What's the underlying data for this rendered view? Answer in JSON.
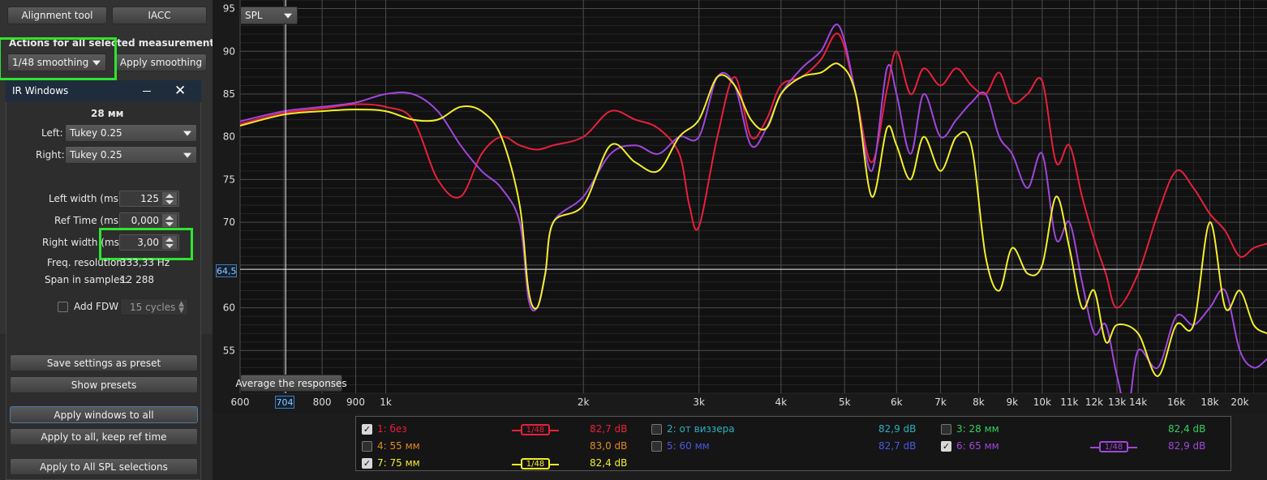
{
  "top_buttons": {
    "alignment": "Alignment tool",
    "iacc": "IACC"
  },
  "actions": {
    "title": "Actions for all selected measurements",
    "smoothing_value": "1/48 smoothing",
    "apply_label": "Apply smoothing"
  },
  "ir_window": {
    "title": "IR Windows",
    "distance": "28 мм",
    "left_label": "Left:",
    "left_value": "Tukey 0.25",
    "right_label": "Right:",
    "right_value": "Tukey 0.25",
    "left_width_label": "Left width (ms):",
    "left_width_value": "125",
    "ref_time_label": "Ref Time (ms):",
    "ref_time_value": "0,000",
    "right_width_label": "Right width (ms):",
    "right_width_value": "3,00",
    "freq_res_label": "Freq. resolution:",
    "freq_res_value": "333,33 Hz",
    "span_label": "Span in samples:",
    "span_value": "12 288",
    "fdw_label": "Add FDW",
    "fdw_value": "15 cycles",
    "save_preset": "Save settings as preset",
    "show_presets": "Show presets",
    "apply_all": "Apply windows to all",
    "apply_keep": "Apply to all, keep ref time",
    "apply_spl": "Apply to All SPL selections"
  },
  "chart_controls": {
    "mode": "SPL",
    "average_button": "Average the responses",
    "cursor_y": "64,5",
    "cursor_x": "704"
  },
  "colors": {
    "red": "#e8203c",
    "purple": "#a046dc",
    "yellow": "#f2ee28",
    "orange": "#e08a1e",
    "teal": "#27b0c0",
    "blue": "#4a5ae0",
    "green": "#30d060",
    "highlight": "#2ee52e"
  },
  "legend": [
    {
      "checked": true,
      "label": "1: без",
      "color": "#e8203c",
      "badge": "1/48",
      "value": "82,7 dB"
    },
    {
      "checked": false,
      "label": "2: от виззера",
      "color": "#27b0c0",
      "badge": "",
      "value": "82,9 dB"
    },
    {
      "checked": false,
      "label": "3: 28 мм",
      "color": "#30d060",
      "badge": "",
      "value": "82,4 dB"
    },
    {
      "checked": false,
      "label": "4: 55 мм",
      "color": "#e08a1e",
      "badge": "",
      "value": "83,0 dB"
    },
    {
      "checked": false,
      "label": "5: 60 мм",
      "color": "#4a5ae0",
      "badge": "",
      "value": "82,7 dB"
    },
    {
      "checked": true,
      "label": "6: 65 мм",
      "color": "#a046dc",
      "badge": "1/48",
      "value": "82,9 dB"
    },
    {
      "checked": true,
      "label": "7: 75 мм",
      "color": "#f2ee28",
      "badge": "1/48",
      "value": "82,4 dB"
    }
  ],
  "chart_data": {
    "type": "line",
    "xscale": "log",
    "xlim": [
      600,
      22000
    ],
    "ylim": [
      50,
      96
    ],
    "x_ticks": [
      600,
      700,
      800,
      900,
      1000,
      2000,
      3000,
      4000,
      5000,
      6000,
      7000,
      8000,
      9000,
      10000,
      11000,
      12000,
      13000,
      14000,
      16000,
      18000,
      20000
    ],
    "x_tick_labels": [
      "600",
      "",
      "800",
      "900",
      "1k",
      "2k",
      "3k",
      "4k",
      "5k",
      "6k",
      "7k",
      "8k",
      "9k",
      "10k",
      "11k",
      "12k",
      "13k",
      "14k",
      "16k",
      "18k",
      "20k"
    ],
    "y_ticks": [
      55,
      60,
      65,
      70,
      75,
      80,
      85,
      90,
      95
    ],
    "y_tick_labels": [
      "55",
      "60",
      "",
      "70",
      "75",
      "80",
      "85",
      "90",
      "95"
    ],
    "cursor": {
      "x": 704,
      "y": 64.5
    },
    "series": [
      {
        "name": "1: без",
        "color": "#e8203c",
        "x": [
          600,
          700,
          800,
          900,
          1000,
          1100,
          1200,
          1300,
          1400,
          1500,
          1600,
          1700,
          1800,
          2000,
          2200,
          2400,
          2600,
          2800,
          2900,
          3000,
          3200,
          3400,
          3600,
          3800,
          4000,
          4300,
          4600,
          4900,
          5200,
          5500,
          5800,
          6000,
          6300,
          6600,
          7000,
          7400,
          7800,
          8200,
          8600,
          9000,
          9500,
          10000,
          10500,
          11000,
          11500,
          12000,
          12500,
          13000,
          14000,
          15000,
          16000,
          17000,
          18000,
          19000,
          20000,
          21000,
          22000
        ],
        "y": [
          81.5,
          82.8,
          83.3,
          83.8,
          83.5,
          82,
          75,
          73,
          78,
          80,
          79,
          78.5,
          79,
          80,
          83,
          82,
          81,
          78,
          72,
          69.5,
          80,
          87,
          80,
          82,
          86,
          87,
          89,
          92,
          85,
          77,
          85.5,
          90,
          85,
          88,
          86,
          88,
          86,
          85,
          87.5,
          84,
          85,
          86.5,
          77,
          79,
          73,
          68,
          64,
          60,
          64,
          71,
          76,
          74,
          71,
          69,
          66,
          67,
          67.5
        ]
      },
      {
        "name": "6: 65 мм",
        "color": "#a046dc",
        "x": [
          600,
          700,
          800,
          900,
          1000,
          1100,
          1200,
          1300,
          1400,
          1500,
          1600,
          1650,
          1700,
          1750,
          1800,
          2000,
          2200,
          2400,
          2600,
          2800,
          3000,
          3200,
          3400,
          3600,
          3800,
          4000,
          4300,
          4600,
          4900,
          5200,
          5500,
          5800,
          6000,
          6300,
          6600,
          7000,
          7400,
          7800,
          8200,
          8600,
          9000,
          9500,
          10000,
          10500,
          11000,
          11500,
          12000,
          12500,
          13000,
          13500,
          14000,
          15000,
          16000,
          17000,
          18000,
          19000,
          20000,
          21000,
          22000
        ],
        "y": [
          81.8,
          83,
          83.5,
          84,
          85,
          85,
          83,
          79,
          76,
          74,
          70,
          61,
          60,
          64,
          70,
          73,
          78,
          79,
          78,
          80,
          80,
          87,
          86,
          79,
          81,
          85,
          88,
          90,
          93,
          85,
          76,
          88,
          85,
          78,
          85,
          80,
          82,
          84,
          85,
          80,
          78,
          74,
          78,
          68,
          70,
          63,
          57,
          58,
          52,
          48,
          55,
          53,
          59,
          58,
          60,
          62,
          55,
          53,
          54
        ]
      },
      {
        "name": "7: 75 мм",
        "color": "#f2ee28",
        "x": [
          600,
          700,
          800,
          900,
          1000,
          1100,
          1200,
          1300,
          1400,
          1500,
          1600,
          1650,
          1700,
          1750,
          1800,
          2000,
          2200,
          2400,
          2600,
          2800,
          3000,
          3200,
          3400,
          3600,
          3800,
          4000,
          4300,
          4600,
          4900,
          5200,
          5500,
          5800,
          6000,
          6300,
          6600,
          7000,
          7400,
          7800,
          8200,
          8600,
          9000,
          9500,
          10000,
          10500,
          11000,
          11500,
          12000,
          12500,
          13000,
          14000,
          15000,
          16000,
          17000,
          18000,
          19000,
          20000,
          21000,
          22000
        ],
        "y": [
          81.3,
          82.6,
          83,
          83.2,
          83,
          82,
          82,
          83.5,
          83,
          80,
          72,
          62,
          60,
          64,
          70,
          72,
          79,
          77,
          76,
          80,
          82,
          87,
          86,
          82,
          81,
          85,
          87,
          87.5,
          88.5,
          85,
          73,
          81,
          79,
          75,
          80,
          76,
          80,
          79,
          66,
          62,
          67,
          64,
          65,
          73,
          67,
          60,
          62,
          56,
          58,
          57,
          52,
          58,
          58,
          70,
          60,
          62,
          58,
          57
        ]
      }
    ]
  }
}
